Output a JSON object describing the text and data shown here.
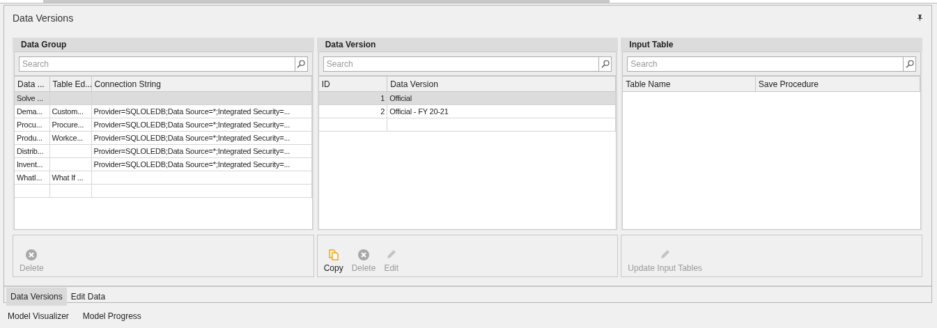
{
  "title": "Data Versions",
  "panels": [
    {
      "title": "Data Group",
      "search": {
        "placeholder": "Search"
      },
      "columns": [
        "Data ...",
        "Table Ed...",
        "Connection String"
      ],
      "rows": [
        {
          "cells": [
            "Solve ...",
            "",
            ""
          ],
          "selected": true
        },
        {
          "cells": [
            "Dema...",
            "Custom...",
            "Provider=SQLOLEDB;Data Source=*;Integrated Security=..."
          ],
          "selected": false
        },
        {
          "cells": [
            "Procu...",
            "Procure...",
            "Provider=SQLOLEDB;Data Source=*;Integrated Security=..."
          ],
          "selected": false
        },
        {
          "cells": [
            "Produ...",
            "Workce...",
            "Provider=SQLOLEDB;Data Source=*;Integrated Security=..."
          ],
          "selected": false
        },
        {
          "cells": [
            "Distrib...",
            "",
            "Provider=SQLOLEDB;Data Source=*;Integrated Security=..."
          ],
          "selected": false
        },
        {
          "cells": [
            "Invent...",
            "",
            "Provider=SQLOLEDB;Data Source=*;Integrated Security=..."
          ],
          "selected": false
        },
        {
          "cells": [
            "WhatI...",
            "What If ...",
            ""
          ],
          "selected": false
        }
      ],
      "buttons": [
        {
          "kind": "delete",
          "label": "Delete",
          "disabled": true
        }
      ]
    },
    {
      "title": "Data Version",
      "search": {
        "placeholder": "Search"
      },
      "columns": [
        "ID",
        "Data Version"
      ],
      "rows": [
        {
          "cells": [
            "1",
            "Official"
          ],
          "selected": true
        },
        {
          "cells": [
            "2",
            "Official - FY 20-21"
          ],
          "selected": false
        }
      ],
      "buttons": [
        {
          "kind": "copy",
          "label": "Copy",
          "disabled": false
        },
        {
          "kind": "delete",
          "label": "Delete",
          "disabled": true
        },
        {
          "kind": "edit",
          "label": "Edit",
          "disabled": true
        }
      ]
    },
    {
      "title": "Input Table",
      "search": {
        "placeholder": "Search"
      },
      "columns": [
        "Table Name",
        "Save Procedure"
      ],
      "buttons": [
        {
          "kind": "edit",
          "label": "Update Input Tables",
          "disabled": true
        }
      ]
    }
  ],
  "tabs": [
    {
      "label": "Data Versions",
      "selected": true
    },
    {
      "label": "Edit Data",
      "selected": false
    }
  ],
  "bottom_tabs": [
    {
      "label": "Model Visualizer"
    },
    {
      "label": "Model Progress"
    }
  ]
}
